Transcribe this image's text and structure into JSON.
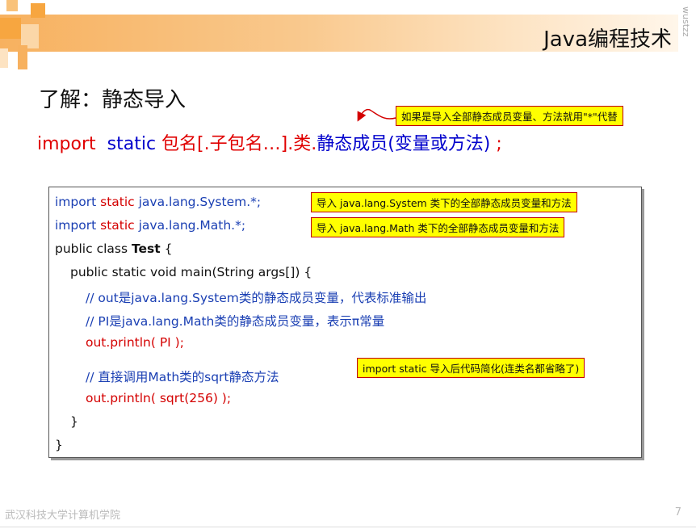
{
  "header": {
    "title": "Java编程技术",
    "watermark": "wustzz"
  },
  "heading": "了解：静态导入",
  "syntax": {
    "import": "import",
    "static": "static",
    "pkg": "包名[.子包名…].",
    "cls": "类.",
    "member": "静态成员(变量或方法)",
    "semicolon": ";"
  },
  "callouts": {
    "wildcard": "如果是导入全部静态成员变量、方法就用\"*\"代替",
    "system": "导入 java.lang.System 类下的全部静态成员变量和方法",
    "math": "导入 java.lang.Math 类下的全部静态成员变量和方法",
    "simplify": "import static 导入后代码简化(连类名都省略了)"
  },
  "code": {
    "l1": {
      "a": "import",
      "b": " static ",
      "c": "java.lang.System.*;"
    },
    "l2": {
      "a": "import",
      "b": " static ",
      "c": "java.lang.Math.*;"
    },
    "l3": {
      "a": "public class ",
      "b": "Test",
      "c": " {"
    },
    "l4": "public static void main(String args[]) {",
    "l5": "// out是java.lang.System类的静态成员变量，代表标准输出",
    "l6": "// PI是java.lang.Math类的静态成员变量，表示π常量",
    "l7": "out.println( PI );",
    "l8": "// 直接调用Math类的sqrt静态方法",
    "l9": "out.println( sqrt(256) );",
    "l10": "}",
    "l11": "}"
  },
  "footer": {
    "school": "武汉科技大学计算机学院",
    "page": "7"
  },
  "colors": {
    "accent": "#f7b15f",
    "code_blue": "#1a3fb3",
    "code_red": "#d40000",
    "callout_bg": "#ffff00"
  }
}
